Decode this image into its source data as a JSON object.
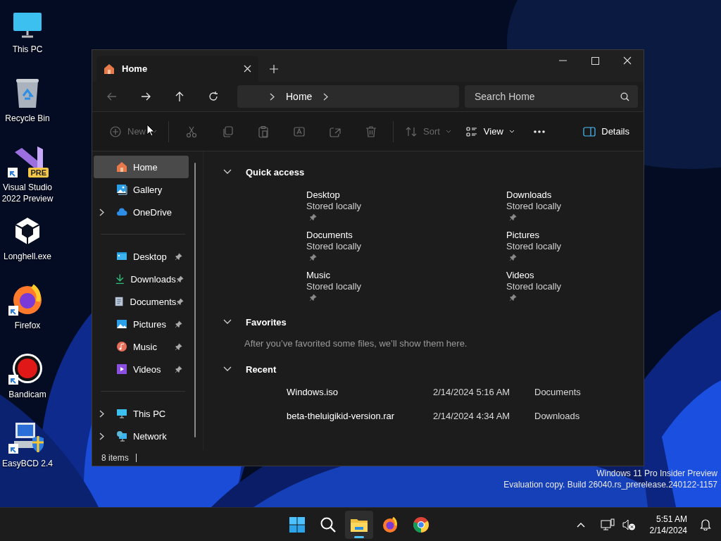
{
  "desktop_icons": [
    {
      "label": "This PC",
      "kind": "monitor",
      "shortcut": false
    },
    {
      "label": "Recycle Bin",
      "kind": "recycle-bin",
      "shortcut": false
    },
    {
      "label": "Visual Studio 2022 Preview",
      "kind": "visual-studio",
      "shortcut": true,
      "badge": "PRE"
    },
    {
      "label": "Longhell.exe",
      "kind": "cube",
      "shortcut": false
    },
    {
      "label": "Firefox",
      "kind": "firefox",
      "shortcut": true
    },
    {
      "label": "Bandicam",
      "kind": "record",
      "shortcut": true
    },
    {
      "label": "EasyBCD 2.4",
      "kind": "computer-shield",
      "shortcut": true
    }
  ],
  "window": {
    "tab": {
      "title": "Home",
      "selected": true
    },
    "nav_buttons": [
      {
        "kind": "back",
        "disabled": true
      },
      {
        "kind": "forward",
        "disabled": false
      },
      {
        "kind": "up",
        "disabled": false
      },
      {
        "kind": "refresh",
        "disabled": false
      }
    ],
    "breadcrumb": [
      "Home"
    ],
    "search": {
      "placeholder": "Search Home"
    },
    "toolbar": {
      "groups": [
        [
          {
            "kind": "new",
            "label": "New",
            "disabled": true,
            "dropdown": true
          }
        ],
        [
          {
            "kind": "cut",
            "disabled": true
          },
          {
            "kind": "copy",
            "disabled": true
          },
          {
            "kind": "paste",
            "disabled": true
          },
          {
            "kind": "rename",
            "disabled": true
          },
          {
            "kind": "share",
            "disabled": true
          },
          {
            "kind": "delete",
            "disabled": true
          }
        ],
        [
          {
            "kind": "sort",
            "label": "Sort",
            "disabled": true,
            "dropdown": true
          },
          {
            "kind": "view",
            "label": "View",
            "disabled": false,
            "dropdown": true
          },
          {
            "kind": "more",
            "disabled": false
          }
        ]
      ],
      "details": {
        "label": "Details"
      }
    },
    "sidebar": {
      "groups": [
        [
          {
            "label": "Home",
            "kind": "home",
            "selected": true,
            "expandable": false,
            "pinned": false
          },
          {
            "label": "Gallery",
            "kind": "gallery",
            "selected": false,
            "expandable": false,
            "pinned": false
          },
          {
            "label": "OneDrive",
            "kind": "cloud",
            "selected": false,
            "expandable": true,
            "pinned": false
          }
        ],
        [
          {
            "label": "Desktop",
            "kind": "desktop",
            "selected": false,
            "expandable": false,
            "pinned": true
          },
          {
            "label": "Downloads",
            "kind": "download",
            "selected": false,
            "expandable": false,
            "pinned": true
          },
          {
            "label": "Documents",
            "kind": "document",
            "selected": false,
            "expandable": false,
            "pinned": true
          },
          {
            "label": "Pictures",
            "kind": "pictures",
            "selected": false,
            "expandable": false,
            "pinned": true
          },
          {
            "label": "Music",
            "kind": "music",
            "selected": false,
            "expandable": false,
            "pinned": true
          },
          {
            "label": "Videos",
            "kind": "video",
            "selected": false,
            "expandable": false,
            "pinned": true
          }
        ],
        [
          {
            "label": "This PC",
            "kind": "monitor",
            "selected": false,
            "expandable": true,
            "pinned": false
          },
          {
            "label": "Network",
            "kind": "network",
            "selected": false,
            "expandable": true,
            "pinned": false
          }
        ]
      ]
    },
    "sections": [
      {
        "kind": "tiles",
        "title": "Quick access",
        "expanded": true,
        "items": [
          {
            "name": "Desktop",
            "status": "Stored locally",
            "pinned": true
          },
          {
            "name": "Downloads",
            "status": "Stored locally",
            "pinned": true
          },
          {
            "name": "Documents",
            "status": "Stored locally",
            "pinned": true
          },
          {
            "name": "Pictures",
            "status": "Stored locally",
            "pinned": true
          },
          {
            "name": "Music",
            "status": "Stored locally",
            "pinned": true
          },
          {
            "name": "Videos",
            "status": "Stored locally",
            "pinned": true
          }
        ]
      },
      {
        "kind": "message",
        "title": "Favorites",
        "expanded": true,
        "message": "After you’ve favorited some files, we’ll show them here."
      },
      {
        "kind": "files",
        "title": "Recent",
        "expanded": true,
        "files": [
          {
            "name": "Windows.iso",
            "date": "2/14/2024 5:16 AM",
            "location": "Documents"
          },
          {
            "name": "beta-theluigikid-version.rar",
            "date": "2/14/2024 4:34 AM",
            "location": "Downloads"
          }
        ]
      }
    ],
    "status_bar": "8 items"
  },
  "watermark": [
    "Windows 11 Pro Insider Preview",
    "Evaluation copy. Build 26040.rs_prerelease.240122-1157"
  ],
  "taskbar": {
    "apps": [
      {
        "kind": "start",
        "active": false
      },
      {
        "kind": "search",
        "active": false
      },
      {
        "kind": "explorer",
        "active": true
      },
      {
        "kind": "firefox",
        "active": false
      },
      {
        "kind": "chrome",
        "active": false
      }
    ],
    "tray": {
      "time": "5:51 AM",
      "date": "2/14/2024"
    }
  }
}
